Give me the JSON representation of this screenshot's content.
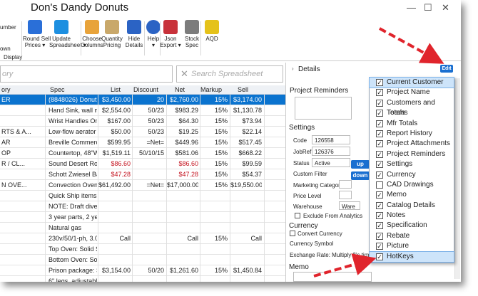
{
  "window": {
    "title": "Don's Dandy Donuts",
    "controls": [
      "—",
      "☐",
      "✕"
    ]
  },
  "ribbon": {
    "fragments": {
      "number": "umber",
      "own": "own",
      "display": "Display"
    },
    "buttons": [
      {
        "id": "round-sell",
        "label": "Round Sell\nPrices ▾",
        "color": "#2a6fd8"
      },
      {
        "id": "update-spreadsheet",
        "label": "Update\nSpreadsheet ▾",
        "color": "#1d8fe0"
      },
      {
        "id": "choose-columns",
        "label": "Choose\nColumns",
        "color": "#e8a33a"
      },
      {
        "id": "quantity-pricing",
        "label": "Quantity\nPricing",
        "color": "#c9a86a"
      },
      {
        "id": "hide-details",
        "label": "Hide\nDetails",
        "color": "#2b63c4"
      },
      {
        "id": "help",
        "label": "Help\n▾",
        "color": "#2b63c4"
      },
      {
        "id": "json-export",
        "label": "Json\nExport ▾",
        "color": "#c8323a"
      },
      {
        "id": "stock-spec",
        "label": "Stock\nSpec",
        "color": "#7c7c7c"
      },
      {
        "id": "aqd",
        "label": "AQD",
        "color": "#e5c21a"
      }
    ]
  },
  "search": {
    "left_placeholder": "ory",
    "right_placeholder": "Search Spreadsheet"
  },
  "grid": {
    "columns": [
      "ory",
      "Spec",
      "List",
      "Discount",
      "Net",
      "Markup",
      "Sell"
    ],
    "rows": [
      {
        "cat": "ER",
        "spec": "(8848026) Donut Fryer, el...",
        "list": "$3,450.00",
        "disc": "20",
        "net": "$2,760.00",
        "mu": "15%",
        "sell": "$3,174.00",
        "sel": true
      },
      {
        "cat": "",
        "spec": "Hand Sink, wall mounted,...",
        "list": "$2,554.00",
        "disc": "50/23",
        "net": "$983.29",
        "mu": "15%",
        "sell": "$1,130.78"
      },
      {
        "cat": "",
        "spec": "Wrist Handles Only, for ...",
        "list": "$167.00",
        "disc": "50/23",
        "net": "$64.30",
        "mu": "15%",
        "sell": "$73.94"
      },
      {
        "cat": "RTS & A...",
        "spec": "Low-flow aerator 0.5gpm,...",
        "list": "$50.00",
        "disc": "50/23",
        "net": "$19.25",
        "mu": "15%",
        "sell": "$22.14"
      },
      {
        "cat": "AR",
        "spec": "Breville Commercial Supe...",
        "list": "$599.95",
        "disc": "=Net=",
        "net": "$449.96",
        "mu": "15%",
        "sell": "$517.45"
      },
      {
        "cat": "OP",
        "spec": "Countertop, 48\"W x 24\"D...",
        "list": "$1,519.11",
        "disc": "50/10/15",
        "net": "$581.06",
        "mu": "15%",
        "sell": "$668.22"
      },
      {
        "cat": "R / CL...",
        "spec": "Sound Desert Rose Plate L...",
        "list": "$86.60",
        "disc": "",
        "net": "$86.60",
        "mu": "15%",
        "sell": "$99.59",
        "red": true
      },
      {
        "cat": "",
        "spec": "Schott Zwiesel Banquet W...",
        "list": "$47.28",
        "disc": "",
        "net": "$47.28",
        "mu": "15%",
        "sell": "$54.37",
        "red": true
      },
      {
        "cat": "N OVE...",
        "spec": "Convection Oven, gas, do...",
        "list": "$61,492.00",
        "disc": "=Net=",
        "net": "$17,000.00",
        "mu": "15%",
        "sell": "$19,550.00"
      },
      {
        "cat": "",
        "spec": "Quick Ship items have limi...",
        "list": "",
        "disc": "",
        "net": "",
        "mu": "",
        "sell": ""
      },
      {
        "cat": "",
        "spec": "NOTE: Draft diverter is no...",
        "list": "",
        "disc": "",
        "net": "",
        "mu": "",
        "sell": ""
      },
      {
        "cat": "",
        "spec": "3 year parts, 2 year labor...",
        "list": "",
        "disc": "",
        "net": "",
        "mu": "",
        "sell": ""
      },
      {
        "cat": "",
        "spec": "Natural gas",
        "list": "",
        "disc": "",
        "net": "",
        "mu": "",
        "sell": ""
      },
      {
        "cat": "",
        "spec": "230v/50/1-ph, 3.0 amps,...",
        "list": "Call",
        "disc": "",
        "net": "Call",
        "mu": "15%",
        "sell": "Call"
      },
      {
        "cat": "",
        "spec": "Top Oven: Solid State infin...",
        "list": "",
        "disc": "",
        "net": "",
        "mu": "",
        "sell": ""
      },
      {
        "cat": "",
        "spec": "Bottom Oven: Solid State...",
        "list": "",
        "disc": "",
        "net": "",
        "mu": "",
        "sell": ""
      },
      {
        "cat": "",
        "spec": "Prison package: Security ...",
        "list": "$3,154.00",
        "disc": "50/20",
        "net": "$1,261.60",
        "mu": "15%",
        "sell": "$1,450.84"
      },
      {
        "cat": "",
        "spec": "6\" legs, adjustable, stainle...",
        "list": "",
        "disc": "",
        "net": "",
        "mu": "",
        "sell": ""
      }
    ]
  },
  "details": {
    "header": "Details",
    "edit_button": "Edit",
    "project_reminders": "Project Reminders",
    "settings": "Settings",
    "code_label": "Code",
    "code_value": "126558",
    "jobref_label": "JobRef",
    "jobref_value": "126376",
    "status_label": "Status",
    "status_value": "Active",
    "custom_filter": "Custom Filter",
    "marketing_category": "Marketing Category",
    "price_level": "Price Level",
    "warehouse_label": "Warehouse",
    "warehouse_value": "Ware",
    "exclude_analytics": "Exclude From Analytics",
    "up": "up",
    "down": "down",
    "currency": "Currency",
    "convert_currency": "Convert Currency",
    "currency_symbol": "Currency Symbol",
    "exchange_rate": "Exchange Rate: Multiply $'s tim",
    "memo": "Memo"
  },
  "menu": {
    "items": [
      {
        "label": "Current Customer",
        "checked": true,
        "hl": true
      },
      {
        "label": "Project Name",
        "checked": true
      },
      {
        "label": "Customers and Teams",
        "checked": true
      },
      {
        "label": "Totals",
        "checked": true
      },
      {
        "label": "Mfr Totals",
        "checked": true
      },
      {
        "label": "Report History",
        "checked": true
      },
      {
        "label": "Project Attachments",
        "checked": true
      },
      {
        "label": "Project Reminders",
        "checked": true
      },
      {
        "label": "Settings",
        "checked": true
      },
      {
        "label": "Currency",
        "checked": true
      },
      {
        "label": "CAD Drawings",
        "checked": false
      },
      {
        "label": "Memo",
        "checked": true
      },
      {
        "label": "Catalog Details",
        "checked": true
      },
      {
        "label": "Notes",
        "checked": true
      },
      {
        "label": "Specification",
        "checked": true
      },
      {
        "label": "Rebate",
        "checked": true
      },
      {
        "label": "Picture",
        "checked": true
      },
      {
        "label": "HotKeys",
        "checked": true,
        "hl": true
      }
    ]
  },
  "colors": {
    "selection": "#0a73cf",
    "accent": "#1a6fd0",
    "arrow": "#e0242c",
    "red_text": "#c4121e"
  }
}
